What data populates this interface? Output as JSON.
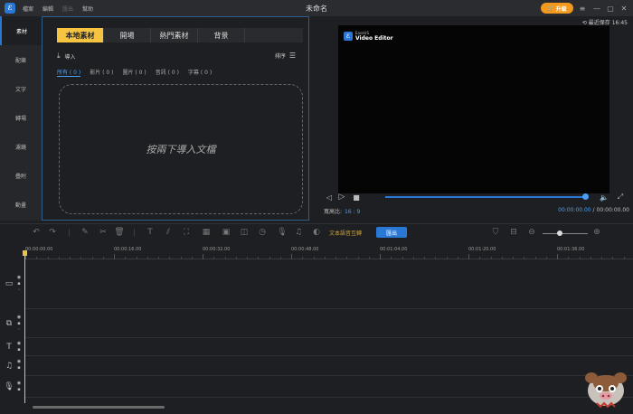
{
  "titlebar": {
    "menu": [
      "檔案",
      "編輯",
      "匯出",
      "幫助"
    ],
    "title": "未命名",
    "upgrade_label": "升級"
  },
  "sidebar": {
    "items": [
      "素材",
      "配樂",
      "文字",
      "轉場",
      "濾鏡",
      "疊附",
      "動畫"
    ]
  },
  "media": {
    "tabs": [
      "本地素材",
      "開場",
      "熱門素材",
      "背景"
    ],
    "import_label": "導入",
    "sort_label": "排序",
    "filters": [
      "所有 ( 0 )",
      "影片 ( 0 )",
      "圖片 ( 0 )",
      "音訊 ( 0 )",
      "字幕 ( 0 )"
    ],
    "dropzone_text": "按兩下導入文檔"
  },
  "preview": {
    "ratio_time": "最近保存 16:45",
    "watermark_small": "EaseUS",
    "watermark_big": "Video Editor",
    "aspect_label": "寬高比:",
    "aspect_value": "16 : 9",
    "time_current": "00:00:00.00",
    "time_separator": "/",
    "time_total": "00:00:00.00"
  },
  "toolbar": {
    "speech_to_text": "文本語音互轉",
    "export_label": "匯出"
  },
  "ruler": {
    "labels": [
      "00:00:00.00",
      "00:00:16.00",
      "00:00:32.00",
      "00:00:48.00",
      "00:01:04.00",
      "00:01:20.00",
      "00:01:36.00"
    ]
  }
}
